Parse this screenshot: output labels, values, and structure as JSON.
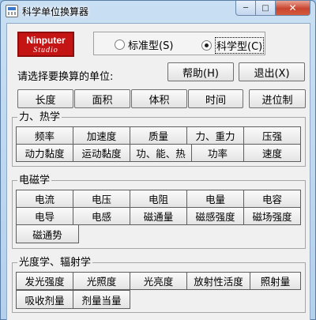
{
  "window": {
    "title": "科学单位换算器",
    "controls": {
      "minimize": "─",
      "maximize": "□",
      "close": "✕"
    }
  },
  "logo": {
    "line1": "Ninputer",
    "line2": "Studio"
  },
  "mode": {
    "options": [
      {
        "label": "标准型(S)",
        "selected": false
      },
      {
        "label": "科学型(C)",
        "selected": true
      }
    ]
  },
  "prompt": "请选择要换算的单位:",
  "actions": {
    "help": "帮助(H)",
    "exit": "退出(X)"
  },
  "top_units": [
    "长度",
    "面积",
    "体积",
    "时间",
    "进位制"
  ],
  "groups": [
    {
      "title": "力、热学",
      "units": [
        "频率",
        "加速度",
        "质量",
        "力、重力",
        "压强",
        "动力黏度",
        "运动黏度",
        "功、能、热",
        "功率",
        "速度"
      ]
    },
    {
      "title": "电磁学",
      "units": [
        "电流",
        "电压",
        "电阻",
        "电量",
        "电容",
        "电导",
        "电感",
        "磁通量",
        "磁感强度",
        "磁场强度",
        "磁通势"
      ]
    },
    {
      "title": "光度学、辐射学",
      "units": [
        "发光强度",
        "光照度",
        "光亮度",
        "放射性活度",
        "照射量",
        "吸收剂量",
        "剂量当量"
      ]
    }
  ]
}
